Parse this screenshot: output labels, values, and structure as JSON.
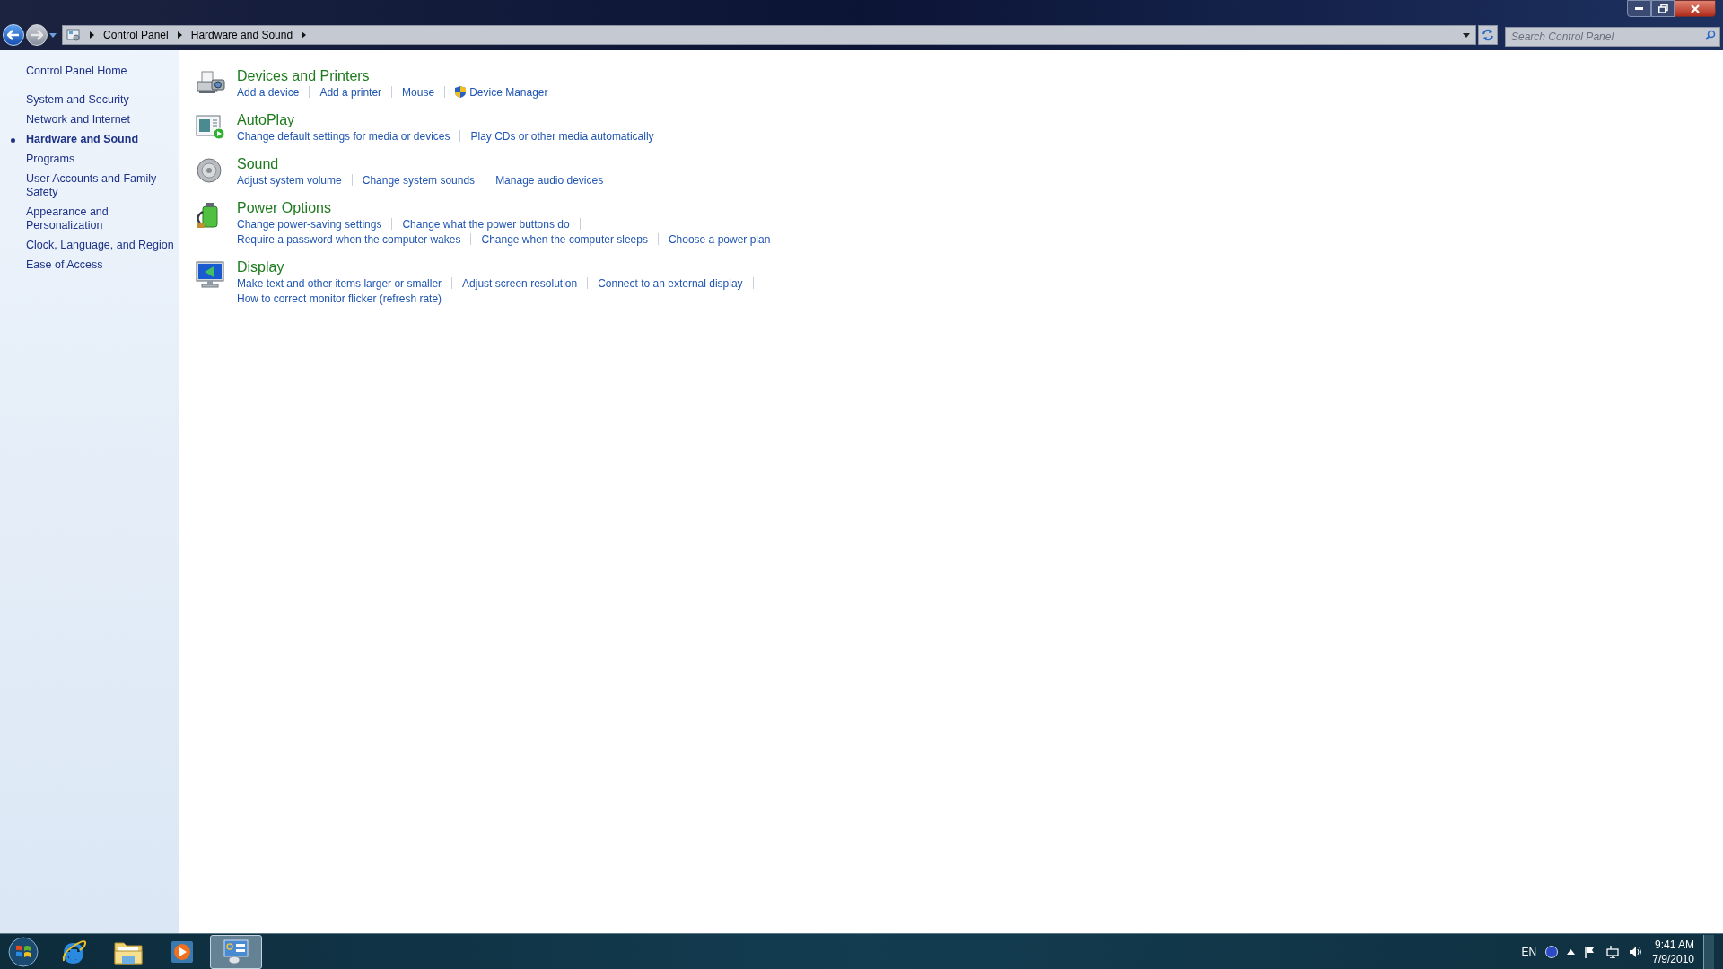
{
  "address_bar": {
    "breadcrumbs": [
      "Control Panel",
      "Hardware and Sound"
    ]
  },
  "search": {
    "placeholder": "Search Control Panel"
  },
  "sidebar": {
    "items": [
      {
        "label": "Control Panel Home",
        "selected": false,
        "kind": "home"
      },
      {
        "label": "System and Security",
        "selected": false,
        "kind": "category"
      },
      {
        "label": "Network and Internet",
        "selected": false,
        "kind": "category"
      },
      {
        "label": "Hardware and Sound",
        "selected": true,
        "kind": "category"
      },
      {
        "label": "Programs",
        "selected": false,
        "kind": "category"
      },
      {
        "label": "User Accounts and Family Safety",
        "selected": false,
        "kind": "category"
      },
      {
        "label": "Appearance and Personalization",
        "selected": false,
        "kind": "category"
      },
      {
        "label": "Clock, Language, and Region",
        "selected": false,
        "kind": "category"
      },
      {
        "label": "Ease of Access",
        "selected": false,
        "kind": "category"
      }
    ]
  },
  "sections": [
    {
      "kind": "devices",
      "title": "Devices and Printers",
      "rows": [
        [
          {
            "label": "Add a device",
            "kind": "link"
          },
          {
            "label": "Add a printer",
            "kind": "link"
          },
          {
            "label": "Mouse",
            "kind": "link"
          },
          {
            "label": "Device Manager",
            "kind": "admin"
          }
        ]
      ]
    },
    {
      "kind": "autoplay",
      "title": "AutoPlay",
      "rows": [
        [
          {
            "label": "Change default settings for media or devices",
            "kind": "link"
          },
          {
            "label": "Play CDs or other media automatically",
            "kind": "link"
          }
        ]
      ]
    },
    {
      "kind": "sound",
      "title": "Sound",
      "rows": [
        [
          {
            "label": "Adjust system volume",
            "kind": "link"
          },
          {
            "label": "Change system sounds",
            "kind": "link"
          },
          {
            "label": "Manage audio devices",
            "kind": "link"
          }
        ]
      ]
    },
    {
      "kind": "power",
      "title": "Power Options",
      "rows": [
        [
          {
            "label": "Change power-saving settings",
            "kind": "link"
          },
          {
            "label": "Change what the power buttons do",
            "kind": "link"
          }
        ],
        [
          {
            "label": "Require a password when the computer wakes",
            "kind": "link"
          },
          {
            "label": "Change when the computer sleeps",
            "kind": "link"
          },
          {
            "label": "Choose a power plan",
            "kind": "link"
          }
        ]
      ]
    },
    {
      "kind": "display",
      "title": "Display",
      "rows": [
        [
          {
            "label": "Make text and other items larger or smaller",
            "kind": "link"
          },
          {
            "label": "Adjust screen resolution",
            "kind": "link"
          },
          {
            "label": "Connect to an external display",
            "kind": "link"
          }
        ],
        [
          {
            "label": "How to correct monitor flicker (refresh rate)",
            "kind": "link"
          }
        ]
      ]
    }
  ],
  "taskbar": {
    "apps": [
      {
        "kind": "browser",
        "selected": false
      },
      {
        "kind": "folder",
        "selected": false
      },
      {
        "kind": "media",
        "selected": false
      },
      {
        "kind": "control-panel",
        "selected": true
      }
    ],
    "tray": {
      "language": "EN",
      "time": "9:41 AM",
      "date": "7/9/2010"
    }
  }
}
